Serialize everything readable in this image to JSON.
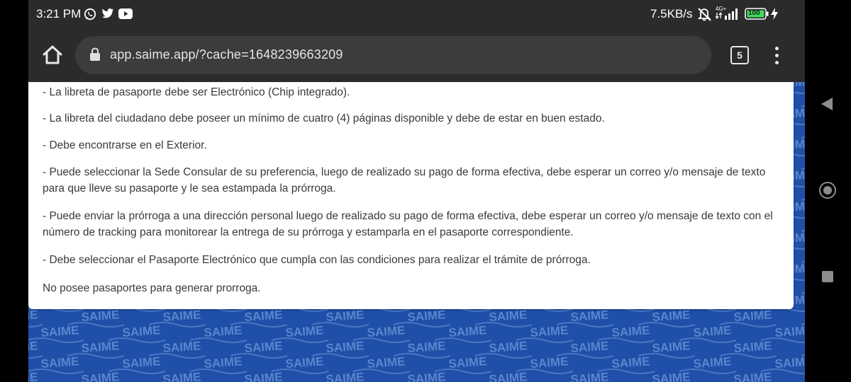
{
  "status_bar": {
    "time": "3:21 PM",
    "app_icons": [
      "whatsapp-icon",
      "twitter-icon",
      "youtube-icon"
    ],
    "net_speed": "7.5KB/s",
    "network_type": "4G+",
    "battery": "100"
  },
  "browser": {
    "url": "app.saime.app/?cache=1648239663209",
    "tab_count": "5"
  },
  "content": {
    "requirements": [
      "- La libreta de pasaporte debe ser Electrónico (Chip integrado).",
      "- La libreta del ciudadano debe poseer un mínimo de cuatro (4) páginas disponible y debe de estar en buen estado.",
      "- Debe encontrarse en el Exterior.",
      "- Puede seleccionar la Sede Consular de su preferencia, luego de realizado su pago de forma efectiva, debe esperar un correo y/o mensaje de texto para que lleve su pasaporte y le sea estampada la prórroga.",
      "- Puede enviar la prórroga a una dirección personal luego de realizado su pago de forma efectiva, debe esperar un correo y/o mensaje de texto con el número de tracking para monitorear la entrega de su prórroga y estamparla en el pasaporte correspondiente.",
      "- Debe seleccionar el Pasaporte Electrónico que cumpla con las condiciones para realizar el trámite de prórroga."
    ],
    "no_passports_message": "No posee pasaportes para generar prorroga."
  },
  "background": {
    "watermark_text": "SAIME",
    "color": "#1f4fa8"
  }
}
